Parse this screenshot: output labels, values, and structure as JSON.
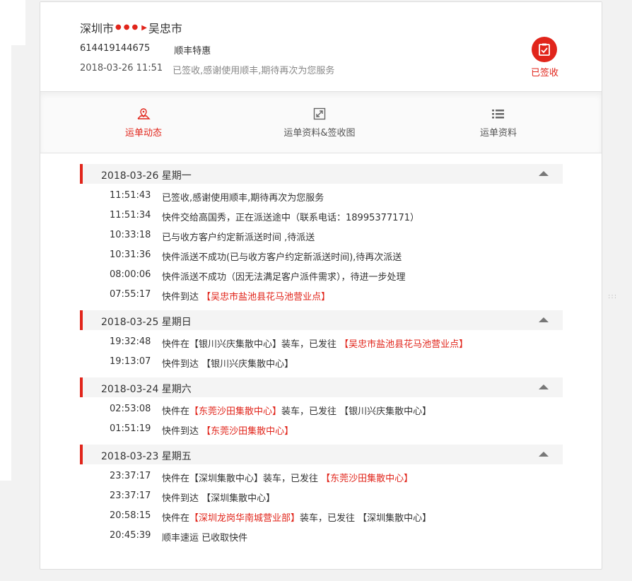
{
  "header": {
    "origin": "深圳市",
    "destination": "吴忠市",
    "waybill_no": "614419144675",
    "service": "顺丰特惠",
    "last_time": "2018-03-26 11:51",
    "last_status": "已签收,感谢使用顺丰,期待再次为您服务",
    "signed_label": "已签收",
    "icons": {
      "route_dots": "dots",
      "route_arrow": "right-triangle",
      "signed": "clipboard-check-icon"
    }
  },
  "tabs": [
    {
      "label": "运单动态",
      "icon": "map-pin-icon",
      "active": true
    },
    {
      "label": "运单资料&签收图",
      "icon": "expand-image-icon",
      "active": false
    },
    {
      "label": "运单资料",
      "icon": "list-icon",
      "active": false
    }
  ],
  "days": [
    {
      "date": "2018-03-26 星期一",
      "events": [
        {
          "time": "11:51:43",
          "parts": [
            "已签收,感谢使用顺丰,期待再次为您服务"
          ]
        },
        {
          "time": "11:51:34",
          "parts": [
            "快件交给高国秀，正在派送途中（联系电话：18995377171）"
          ]
        },
        {
          "time": "10:33:18",
          "parts": [
            "已与收方客户约定新派送时间 ,待派送"
          ]
        },
        {
          "time": "10:31:36",
          "parts": [
            "快件派送不成功(已与收方客户约定新派送时间),待再次派送"
          ]
        },
        {
          "time": "08:00:06",
          "parts": [
            "快件派送不成功（因无法满足客户派件需求），待进一步处理"
          ]
        },
        {
          "time": "07:55:17",
          "parts": [
            "快件到达 ",
            "【吴忠市盐池县花马池营业点】"
          ]
        }
      ]
    },
    {
      "date": "2018-03-25 星期日",
      "events": [
        {
          "time": "19:32:48",
          "parts": [
            "快件在【银川兴庆集散中心】装车，已发往 ",
            "【吴忠市盐池县花马池营业点】"
          ]
        },
        {
          "time": "19:13:07",
          "parts": [
            "快件到达 【银川兴庆集散中心】"
          ]
        }
      ]
    },
    {
      "date": "2018-03-24 星期六",
      "events": [
        {
          "time": "02:53:08",
          "parts": [
            "快件在",
            "【东莞沙田集散中心】",
            "装车，已发往 【银川兴庆集散中心】"
          ]
        },
        {
          "time": "01:51:19",
          "parts": [
            "快件到达 ",
            "【东莞沙田集散中心】"
          ]
        }
      ]
    },
    {
      "date": "2018-03-23 星期五",
      "events": [
        {
          "time": "23:37:17",
          "parts": [
            "快件在【深圳集散中心】装车，已发往 ",
            "【东莞沙田集散中心】"
          ]
        },
        {
          "time": "23:37:17",
          "parts": [
            "快件到达 【深圳集散中心】"
          ]
        },
        {
          "time": "20:58:15",
          "parts": [
            "快件在",
            "【深圳龙岗华南城营业部】",
            "装车，已发往 【深圳集散中心】"
          ]
        },
        {
          "time": "20:45:39",
          "parts": [
            "顺丰速运 已收取快件"
          ]
        }
      ]
    }
  ],
  "colors": {
    "accent": "#e1251b",
    "text": "#333333",
    "muted": "#888888",
    "day_bg": "#f4f4f4"
  }
}
